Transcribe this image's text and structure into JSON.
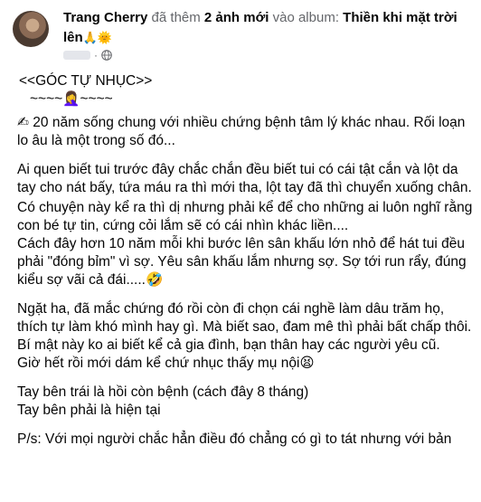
{
  "post": {
    "author": "Trang Cherry",
    "action_pre": "đã thêm",
    "action_count": "2 ảnh mới",
    "action_mid": "vào album:",
    "album": "Thiền khi mặt trời lên",
    "album_emoji": "🙏🌞",
    "visibility_icon": "globe-icon"
  },
  "content": {
    "title": "<<GÓC TỰ NHỤC>>",
    "decor": "~~~~🤦‍♀️~~~~",
    "p1": "✍ 20 năm sống chung với nhiều chứng bệnh tâm lý khác nhau. Rối loạn lo âu là một trong số đó...",
    "p2": "Ai quen biết tui trước đây chắc chắn đều biết tui có cái tật cắn và lột da tay cho nát bấy, tứa máu ra thì mới tha, lột tay đã thì chuyển xuống chân.",
    "p3": "Có chuyện này kể ra thì dị nhưng phải kể để cho những ai luôn nghĩ rằng con bé tự tin, cứng cỏi lắm sẽ có cái nhìn khác liền....",
    "p4": "Cách đây hơn 10 năm mỗi khi bước lên sân khấu lớn nhỏ để hát tui đều phải \"đóng bỉm\" vì sợ. Yêu sân khấu lắm nhưng sợ. Sợ tới run rẩy, đúng kiểu sợ vãi cả đái.....🤣",
    "p5": "Ngặt ha, đã mắc chứng đó rồi còn đi chọn cái nghề làm dâu trăm họ, thích tự làm khó mình hay gì. Mà biết sao, đam mê thì phải bất chấp thôi.",
    "p6": "Bí mật này ko ai biết kể cả gia đình, bạn thân hay các người yêu cũ.",
    "p7": "Giờ hết rồi mới dám kể chứ nhục thấy mụ nội😫",
    "p8": "Tay bên trái là hồi còn bệnh (cách đây 8 tháng)",
    "p9": "Tay bên phải là hiện tại",
    "p10": "P/s: Với mọi người chắc hẳn điều đó chẳng có gì to tát nhưng với bản"
  }
}
